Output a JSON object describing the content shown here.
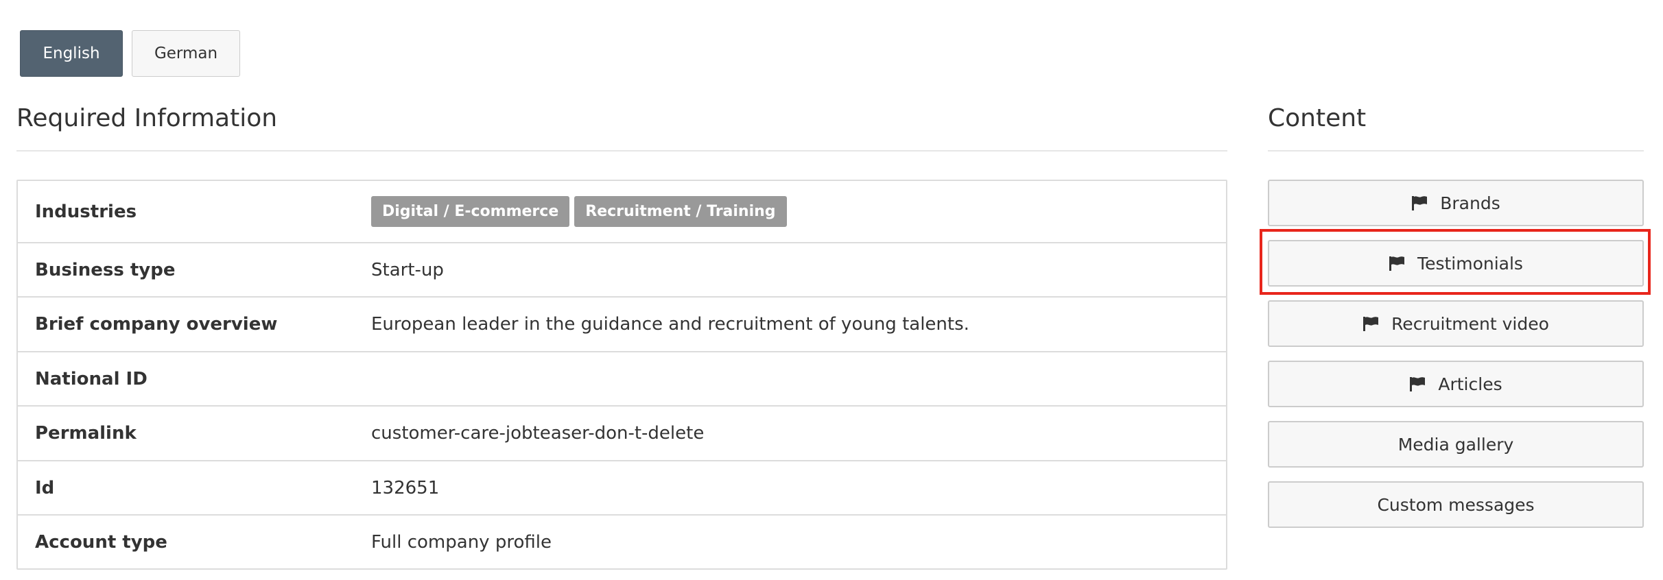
{
  "language_tabs": [
    {
      "label": "English",
      "active": true
    },
    {
      "label": "German",
      "active": false
    }
  ],
  "required_info": {
    "title": "Required Information",
    "rows": [
      {
        "label": "Industries",
        "tags": [
          "Digital / E-commerce",
          "Recruitment / Training"
        ]
      },
      {
        "label": "Business type",
        "value": "Start-up"
      },
      {
        "label": "Brief company overview",
        "value": "European leader in the guidance and recruitment of young talents."
      },
      {
        "label": "National ID",
        "value": ""
      },
      {
        "label": "Permalink",
        "value": "customer-care-jobteaser-don-t-delete"
      },
      {
        "label": "Id",
        "value": "132651"
      },
      {
        "label": "Account type",
        "value": "Full company profile"
      }
    ]
  },
  "content": {
    "title": "Content",
    "buttons": [
      {
        "label": "Brands",
        "icon": "flag-icon"
      },
      {
        "label": "Testimonials",
        "icon": "flag-icon",
        "highlighted": true
      },
      {
        "label": "Recruitment video",
        "icon": "flag-icon"
      },
      {
        "label": "Articles",
        "icon": "flag-icon"
      },
      {
        "label": "Media gallery"
      },
      {
        "label": "Custom messages"
      }
    ]
  },
  "colors": {
    "active_tab": "#536371",
    "tag_bg": "#999999",
    "highlight": "#e8261c"
  }
}
